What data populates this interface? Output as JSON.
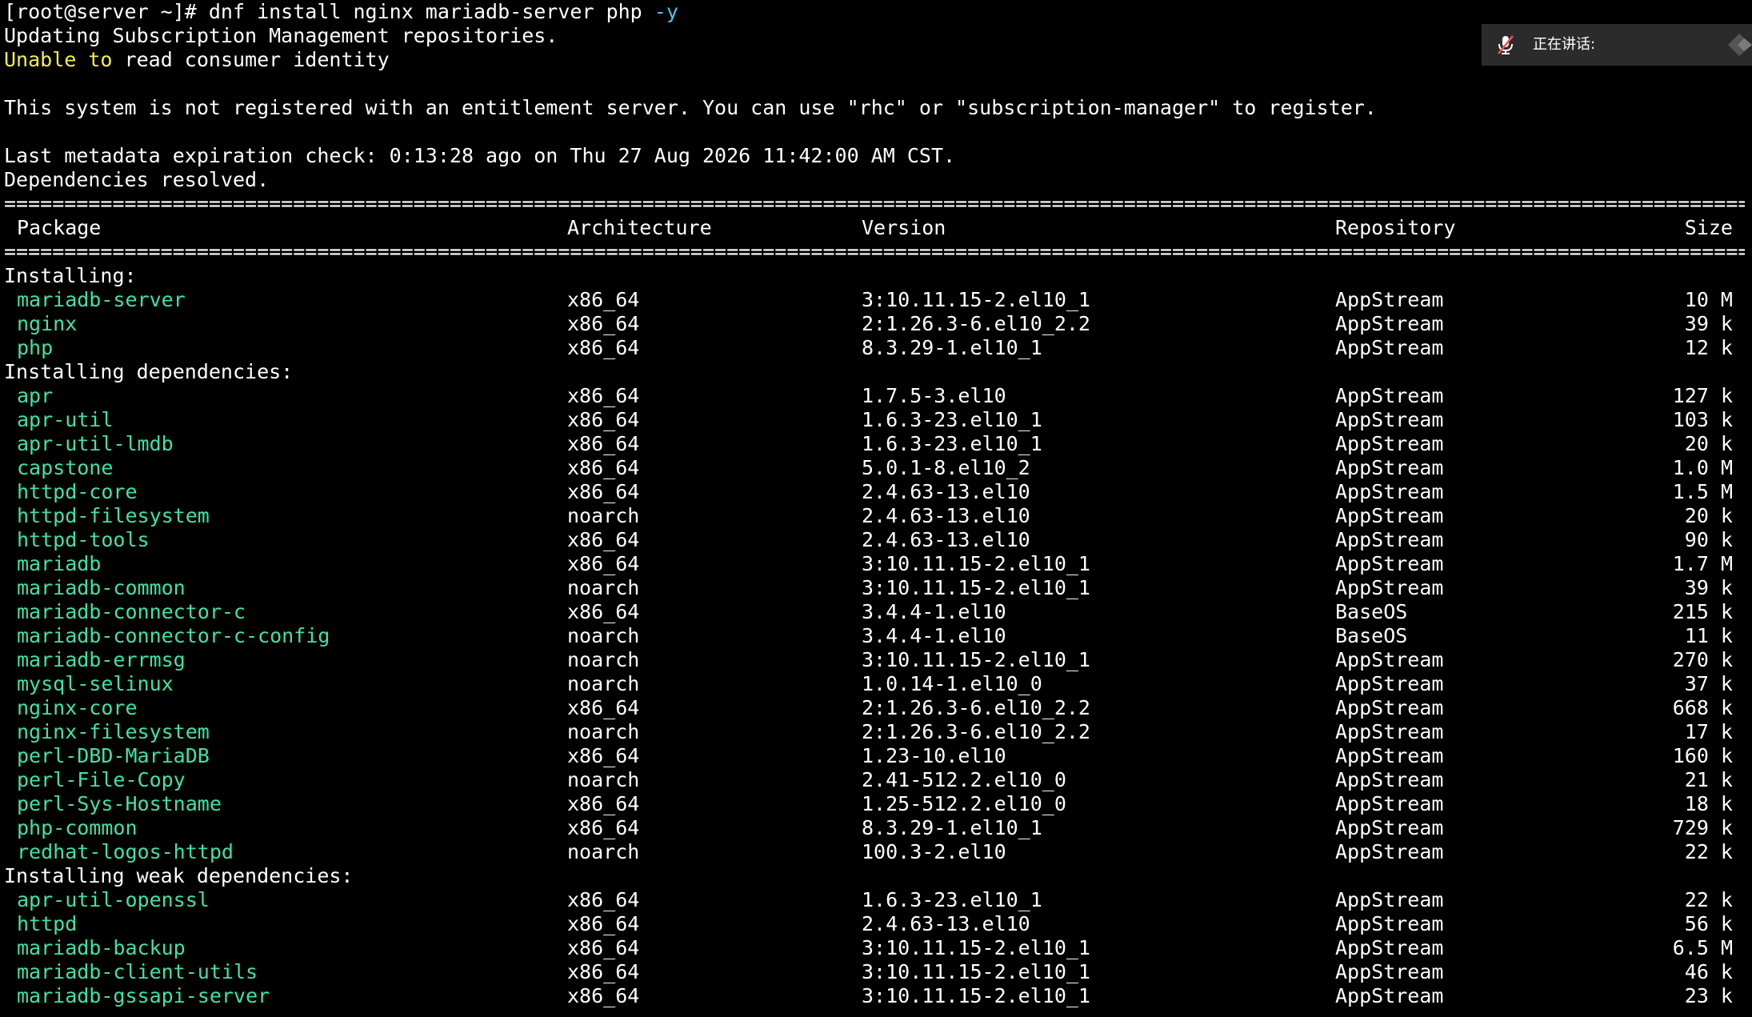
{
  "terminal": {
    "prompt": "[root@server ~]# ",
    "command": "dnf install nginx mariadb-server php ",
    "command_flag": "-y",
    "line_updating": "Updating Subscription Management repositories.",
    "unable_word": "Unable",
    "to_word": "to",
    "unable_rest": " read consumer identity",
    "not_registered": "This system is not registered with an entitlement server. You can use \"rhc\" or \"subscription-manager\" to register.",
    "metadata_check": "Last metadata expiration check: 0:13:28 ago on Thu 27 Aug 2026 11:42:00 AM CST.",
    "deps_resolved": "Dependencies resolved.",
    "separator": "===================================================================================================================================================================================================="
  },
  "table": {
    "headers": {
      "package": "Package",
      "architecture": "Architecture",
      "version": "Version",
      "repository": "Repository",
      "size": "Size"
    },
    "sections": [
      {
        "title": "Installing:",
        "rows": [
          {
            "package": "mariadb-server",
            "arch": "x86_64",
            "version": "3:10.11.15-2.el10_1",
            "repo": "AppStream",
            "size": "10 M"
          },
          {
            "package": "nginx",
            "arch": "x86_64",
            "version": "2:1.26.3-6.el10_2.2",
            "repo": "AppStream",
            "size": "39 k"
          },
          {
            "package": "php",
            "arch": "x86_64",
            "version": "8.3.29-1.el10_1",
            "repo": "AppStream",
            "size": "12 k"
          }
        ]
      },
      {
        "title": "Installing dependencies:",
        "rows": [
          {
            "package": "apr",
            "arch": "x86_64",
            "version": "1.7.5-3.el10",
            "repo": "AppStream",
            "size": "127 k"
          },
          {
            "package": "apr-util",
            "arch": "x86_64",
            "version": "1.6.3-23.el10_1",
            "repo": "AppStream",
            "size": "103 k"
          },
          {
            "package": "apr-util-lmdb",
            "arch": "x86_64",
            "version": "1.6.3-23.el10_1",
            "repo": "AppStream",
            "size": "20 k"
          },
          {
            "package": "capstone",
            "arch": "x86_64",
            "version": "5.0.1-8.el10_2",
            "repo": "AppStream",
            "size": "1.0 M"
          },
          {
            "package": "httpd-core",
            "arch": "x86_64",
            "version": "2.4.63-13.el10",
            "repo": "AppStream",
            "size": "1.5 M"
          },
          {
            "package": "httpd-filesystem",
            "arch": "noarch",
            "version": "2.4.63-13.el10",
            "repo": "AppStream",
            "size": "20 k"
          },
          {
            "package": "httpd-tools",
            "arch": "x86_64",
            "version": "2.4.63-13.el10",
            "repo": "AppStream",
            "size": "90 k"
          },
          {
            "package": "mariadb",
            "arch": "x86_64",
            "version": "3:10.11.15-2.el10_1",
            "repo": "AppStream",
            "size": "1.7 M"
          },
          {
            "package": "mariadb-common",
            "arch": "noarch",
            "version": "3:10.11.15-2.el10_1",
            "repo": "AppStream",
            "size": "39 k"
          },
          {
            "package": "mariadb-connector-c",
            "arch": "x86_64",
            "version": "3.4.4-1.el10",
            "repo": "BaseOS",
            "size": "215 k"
          },
          {
            "package": "mariadb-connector-c-config",
            "arch": "noarch",
            "version": "3.4.4-1.el10",
            "repo": "BaseOS",
            "size": "11 k"
          },
          {
            "package": "mariadb-errmsg",
            "arch": "noarch",
            "version": "3:10.11.15-2.el10_1",
            "repo": "AppStream",
            "size": "270 k"
          },
          {
            "package": "mysql-selinux",
            "arch": "noarch",
            "version": "1.0.14-1.el10_0",
            "repo": "AppStream",
            "size": "37 k"
          },
          {
            "package": "nginx-core",
            "arch": "x86_64",
            "version": "2:1.26.3-6.el10_2.2",
            "repo": "AppStream",
            "size": "668 k"
          },
          {
            "package": "nginx-filesystem",
            "arch": "noarch",
            "version": "2:1.26.3-6.el10_2.2",
            "repo": "AppStream",
            "size": "17 k"
          },
          {
            "package": "perl-DBD-MariaDB",
            "arch": "x86_64",
            "version": "1.23-10.el10",
            "repo": "AppStream",
            "size": "160 k"
          },
          {
            "package": "perl-File-Copy",
            "arch": "noarch",
            "version": "2.41-512.2.el10_0",
            "repo": "AppStream",
            "size": "21 k"
          },
          {
            "package": "perl-Sys-Hostname",
            "arch": "x86_64",
            "version": "1.25-512.2.el10_0",
            "repo": "AppStream",
            "size": "18 k"
          },
          {
            "package": "php-common",
            "arch": "x86_64",
            "version": "8.3.29-1.el10_1",
            "repo": "AppStream",
            "size": "729 k"
          },
          {
            "package": "redhat-logos-httpd",
            "arch": "noarch",
            "version": "100.3-2.el10",
            "repo": "AppStream",
            "size": "22 k"
          }
        ]
      },
      {
        "title": "Installing weak dependencies:",
        "rows": [
          {
            "package": "apr-util-openssl",
            "arch": "x86_64",
            "version": "1.6.3-23.el10_1",
            "repo": "AppStream",
            "size": "22 k"
          },
          {
            "package": "httpd",
            "arch": "x86_64",
            "version": "2.4.63-13.el10",
            "repo": "AppStream",
            "size": "56 k"
          },
          {
            "package": "mariadb-backup",
            "arch": "x86_64",
            "version": "3:10.11.15-2.el10_1",
            "repo": "AppStream",
            "size": "6.5 M"
          },
          {
            "package": "mariadb-client-utils",
            "arch": "x86_64",
            "version": "3:10.11.15-2.el10_1",
            "repo": "AppStream",
            "size": "46 k"
          },
          {
            "package": "mariadb-gssapi-server",
            "arch": "x86_64",
            "version": "3:10.11.15-2.el10_1",
            "repo": "AppStream",
            "size": "23 k"
          }
        ]
      }
    ]
  },
  "overlay": {
    "label": "正在讲话:",
    "mic_icon": "muted-microphone-icon",
    "grip_icon": "drag-handle-icon"
  },
  "colors": {
    "background": "#000000",
    "text": "#ffffff",
    "package_green": "#3ee3a6",
    "warning_yellow": "#f5ef4c",
    "flag_cyan": "#4fc3f7"
  }
}
